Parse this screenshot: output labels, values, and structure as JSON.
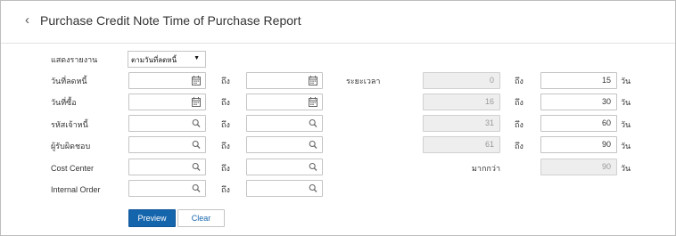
{
  "header": {
    "back_icon": "chevron-left-icon",
    "title": "Purchase Credit Note Time of Purchase Report"
  },
  "form": {
    "show_report": {
      "label": "แสดงรายงาน",
      "value": "ตามวันที่ลดหนี้"
    },
    "to_label": "ถึง",
    "rows": [
      {
        "label": "วันที่ลดหนี้",
        "icon": "calendar-icon"
      },
      {
        "label": "วันที่ซื้อ",
        "icon": "calendar-icon"
      },
      {
        "label": "รหัสเจ้าหนี้",
        "icon": "search-icon"
      },
      {
        "label": "ผู้รับผิดชอบ",
        "icon": "search-icon"
      },
      {
        "label": "Cost Center",
        "icon": "search-icon"
      },
      {
        "label": "Internal Order",
        "icon": "search-icon"
      }
    ]
  },
  "period": {
    "label": "ระยะเวลา",
    "to_label": "ถึง",
    "unit": "วัน",
    "more_than_label": "มากกว่า",
    "rows": [
      {
        "from": "0",
        "to": "15"
      },
      {
        "from": "16",
        "to": "30"
      },
      {
        "from": "31",
        "to": "60"
      },
      {
        "from": "61",
        "to": "90"
      }
    ],
    "more_than_value": "90"
  },
  "buttons": {
    "preview": "Preview",
    "clear": "Clear"
  }
}
